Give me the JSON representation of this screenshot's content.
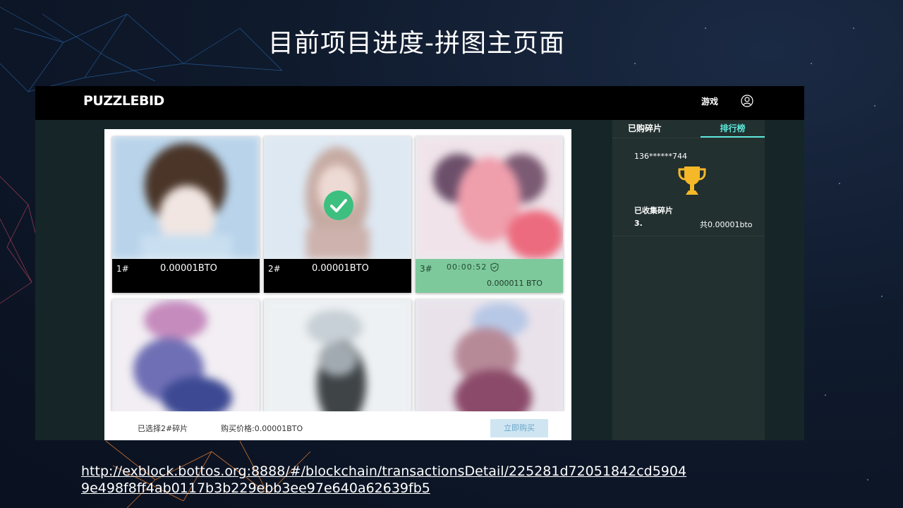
{
  "slide": {
    "title": "目前项目进度-拼图主页面",
    "link_line1": "http://exblock.bottos.org:8888/#/blockchain/transactionsDetail/225281d72051842cd5904",
    "link_line2": "9e498f8ff4ab0117b3b229ebb3ee97e640a62639fb5"
  },
  "app": {
    "logo": "PUZZLEBID",
    "nav_game": "游戏",
    "user_icon": "user-circle-icon"
  },
  "tiles": [
    {
      "num": "1#",
      "price": "0.00001BTO",
      "state": "normal"
    },
    {
      "num": "2#",
      "price": "0.00001BTO",
      "state": "selected"
    },
    {
      "num": "3#",
      "timer": "00:00:52",
      "price": "0.000011 BTO",
      "state": "bidding"
    },
    {
      "num": "",
      "price": "",
      "state": "normal"
    },
    {
      "num": "",
      "price": "",
      "state": "normal"
    },
    {
      "num": "",
      "price": "",
      "state": "normal"
    }
  ],
  "bottom": {
    "selected": "已选择2#碎片",
    "price": "购买价格:0.00001BTO",
    "buy_button": "立即购买"
  },
  "sidebar": {
    "tab_purchased": "已购碎片",
    "tab_ranking": "排行榜",
    "user_id": "136******744",
    "collected_label": "已收集碎片",
    "rank_number": "3.",
    "total": "共0.00001bto"
  },
  "colors": {
    "accent": "#5de6d8",
    "bidding_green": "#7ec99c",
    "check_green": "#3cbf7f",
    "trophy_gold": "#f5b829",
    "buy_button_bg": "#cfe6f2"
  }
}
